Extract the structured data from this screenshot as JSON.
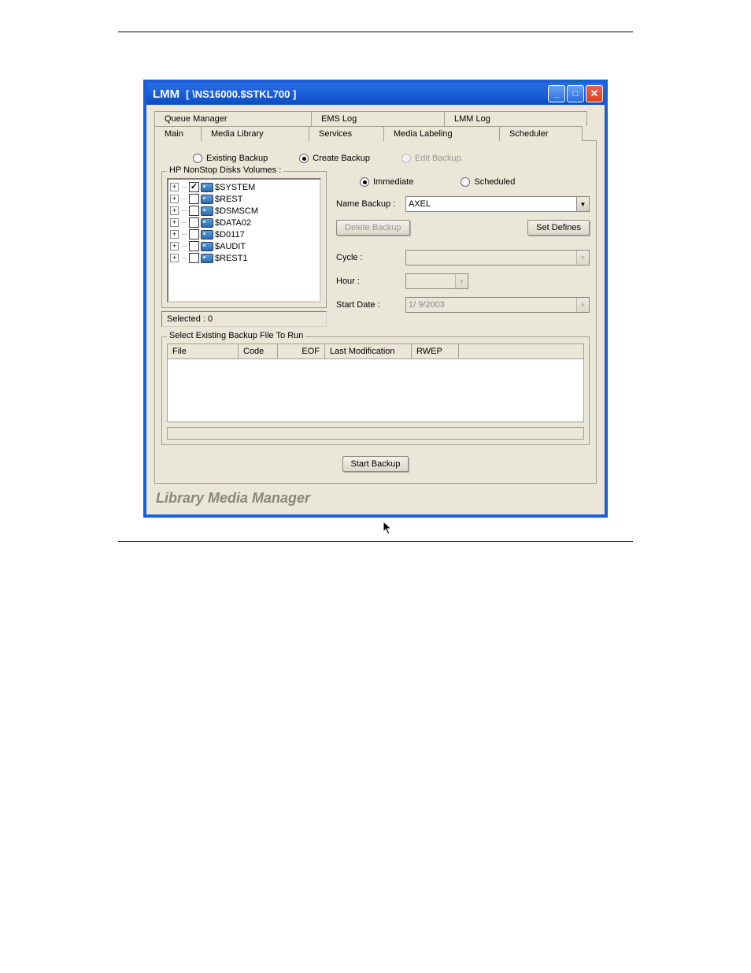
{
  "title": {
    "app": "LMM",
    "path": "[ \\NS16000.$STKL700 ]"
  },
  "tabs": {
    "row1": [
      "Queue Manager",
      "EMS Log",
      "LMM Log"
    ],
    "row2": [
      "Main",
      "Media Library",
      "Services",
      "Media Labeling",
      "Scheduler"
    ]
  },
  "backup_mode": {
    "existing": "Existing Backup",
    "create": "Create Backup",
    "edit": "Edit Backup",
    "selected": "create"
  },
  "volumes": {
    "legend": "HP NonStop Disks Volumes :",
    "items": [
      {
        "name": "$SYSTEM",
        "checked": true
      },
      {
        "name": "$REST",
        "checked": false
      },
      {
        "name": "$DSMSCM",
        "checked": false
      },
      {
        "name": "$DATA02",
        "checked": false
      },
      {
        "name": "$D0117",
        "checked": false
      },
      {
        "name": "$AUDIT",
        "checked": false
      },
      {
        "name": "$REST1",
        "checked": false
      }
    ],
    "selected_text": "Selected : 0"
  },
  "schedule": {
    "immediate": "Immediate",
    "scheduled": "Scheduled",
    "selected": "immediate",
    "name_label": "Name Backup :",
    "name_value": "AXEL",
    "delete_btn": "Delete Backup",
    "defines_btn": "Set Defines",
    "cycle_label": "Cycle :",
    "hour_label": "Hour :",
    "start_date_label": "Start Date :",
    "start_date_value": " 1/ 9/2003"
  },
  "files": {
    "legend": "Select Existing Backup File To Run",
    "cols": {
      "file": "File",
      "code": "Code",
      "eof": "EOF",
      "last_mod": "Last Modification",
      "rwep": "RWEP"
    }
  },
  "start_btn": "Start Backup",
  "footer": "Library Media Manager"
}
